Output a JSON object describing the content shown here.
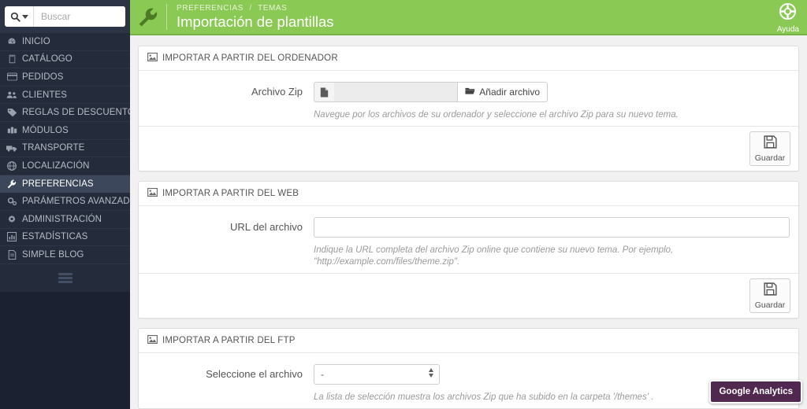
{
  "colors": {
    "sidebar_bg": "#242b3b",
    "sidebar_active": "#3d475c",
    "header_green": "#8bc955",
    "ga_purple": "#51284f",
    "page_bg": "#f1f1f1"
  },
  "sidebar": {
    "search": {
      "placeholder": "Buscar",
      "value": ""
    },
    "items": [
      {
        "label": "INICIO",
        "icon": "dashboard-icon",
        "active": false
      },
      {
        "label": "CATÁLOGO",
        "icon": "book-icon",
        "active": false
      },
      {
        "label": "PEDIDOS",
        "icon": "credit-card-icon",
        "active": false
      },
      {
        "label": "CLIENTES",
        "icon": "users-icon",
        "active": false
      },
      {
        "label": "REGLAS DE DESCUENTOS",
        "icon": "tag-icon",
        "active": false
      },
      {
        "label": "MÓDULOS",
        "icon": "puzzle-icon",
        "active": false
      },
      {
        "label": "TRANSPORTE",
        "icon": "truck-icon",
        "active": false
      },
      {
        "label": "LOCALIZACIÓN",
        "icon": "globe-icon",
        "active": false
      },
      {
        "label": "PREFERENCIAS",
        "icon": "wrench-icon",
        "active": true
      },
      {
        "label": "PARÁMETROS AVANZADOS",
        "icon": "cogs-icon",
        "active": false
      },
      {
        "label": "ADMINISTRACIÓN",
        "icon": "gear-icon",
        "active": false
      },
      {
        "label": "ESTADÍSTICAS",
        "icon": "bar-chart-icon",
        "active": false
      },
      {
        "label": "SIMPLE BLOG",
        "icon": "file-icon",
        "active": false
      }
    ]
  },
  "header": {
    "breadcrumb": [
      "PREFERENCIAS",
      "TEMAS"
    ],
    "breadcrumb_separator": "/",
    "title": "Importación de plantillas",
    "help_label": "Ayuda"
  },
  "panels": [
    {
      "heading": "IMPORTAR A PARTIR DEL ORDENADOR",
      "field_label": "Archivo Zip",
      "file_value": "",
      "browse_label": "Añadir archivo",
      "hint": "Navegue por los archivos de su ordenador y seleccione el archivo Zip para su nuevo tema.",
      "save_label": "Guardar"
    },
    {
      "heading": "IMPORTAR A PARTIR DEL WEB",
      "field_label": "URL del archivo",
      "url_value": "",
      "hint": "Indique la URL completa del archivo Zip online que contiene su nuevo tema. Por ejemplo, \"http://example.com/files/theme.zip\".",
      "save_label": "Guardar"
    },
    {
      "heading": "IMPORTAR A PARTIR DEL FTP",
      "field_label": "Seleccione el archivo",
      "select_value": "-",
      "hint": "La lista de selección muestra los archivos Zip que ha subido en la carpeta '/themes' ."
    }
  ],
  "footer_badge": {
    "label": "Google Analytics"
  }
}
